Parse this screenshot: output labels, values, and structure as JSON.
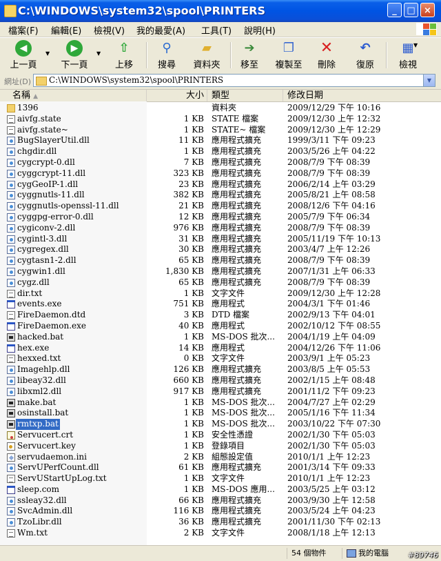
{
  "window": {
    "title": "C:\\WINDOWS\\system32\\spool\\PRINTERS"
  },
  "menu": [
    "檔案(F)",
    "編輯(E)",
    "檢視(V)",
    "我的最愛(A)",
    "工具(T)",
    "說明(H)"
  ],
  "toolbar": {
    "back": "上一頁",
    "forward": "下一頁",
    "up": "上移",
    "search": "搜尋",
    "folders": "資料夾",
    "move_to": "移至",
    "copy_to": "複製至",
    "delete": "刪除",
    "undo": "復原",
    "views": "檢視"
  },
  "address": {
    "label": "網址(D)",
    "value": "C:\\WINDOWS\\system32\\spool\\PRINTERS"
  },
  "columns": {
    "name": "名稱",
    "size": "大小",
    "type": "類型",
    "date": "修改日期"
  },
  "files": [
    {
      "name": "1396",
      "size": "",
      "type": "資料夾",
      "date": "2009/12/29 下午 10:16",
      "icon": "folder"
    },
    {
      "name": "aivfg.state",
      "size": "1 KB",
      "type": "STATE 檔案",
      "date": "2009/12/30 上午 12:32",
      "icon": "doc"
    },
    {
      "name": "aivfg.state~",
      "size": "1 KB",
      "type": "STATE~ 檔案",
      "date": "2009/12/30 上午 12:29",
      "icon": "doc"
    },
    {
      "name": "BugSlayerUtil.dll",
      "size": "11 KB",
      "type": "應用程式擴充",
      "date": "1999/3/11 下午 09:23",
      "icon": "dll"
    },
    {
      "name": "chgdir.dll",
      "size": "1 KB",
      "type": "應用程式擴充",
      "date": "2003/5/26 上午 04:22",
      "icon": "dll"
    },
    {
      "name": "cygcrypt-0.dll",
      "size": "7 KB",
      "type": "應用程式擴充",
      "date": "2008/7/9 下午 08:39",
      "icon": "dll"
    },
    {
      "name": "cyggcrypt-11.dll",
      "size": "323 KB",
      "type": "應用程式擴充",
      "date": "2008/7/9 下午 08:39",
      "icon": "dll"
    },
    {
      "name": "cygGeoIP-1.dll",
      "size": "23 KB",
      "type": "應用程式擴充",
      "date": "2006/2/14 上午 03:29",
      "icon": "dll"
    },
    {
      "name": "cyggnutls-11.dll",
      "size": "382 KB",
      "type": "應用程式擴充",
      "date": "2005/8/21 上午 08:58",
      "icon": "dll"
    },
    {
      "name": "cyggnutls-openssl-11.dll",
      "size": "21 KB",
      "type": "應用程式擴充",
      "date": "2008/12/6 下午 04:16",
      "icon": "dll"
    },
    {
      "name": "cyggpg-error-0.dll",
      "size": "12 KB",
      "type": "應用程式擴充",
      "date": "2005/7/9 下午 06:34",
      "icon": "dll"
    },
    {
      "name": "cygiconv-2.dll",
      "size": "976 KB",
      "type": "應用程式擴充",
      "date": "2008/7/9 下午 08:39",
      "icon": "dll"
    },
    {
      "name": "cygintl-3.dll",
      "size": "31 KB",
      "type": "應用程式擴充",
      "date": "2005/11/19 下午 10:13",
      "icon": "dll"
    },
    {
      "name": "cygregex.dll",
      "size": "30 KB",
      "type": "應用程式擴充",
      "date": "2003/4/7 上午 12:26",
      "icon": "dll"
    },
    {
      "name": "cygtasn1-2.dll",
      "size": "65 KB",
      "type": "應用程式擴充",
      "date": "2008/7/9 下午 08:39",
      "icon": "dll"
    },
    {
      "name": "cygwin1.dll",
      "size": "1,830 KB",
      "type": "應用程式擴充",
      "date": "2007/1/31 上午 06:33",
      "icon": "dll"
    },
    {
      "name": "cygz.dll",
      "size": "65 KB",
      "type": "應用程式擴充",
      "date": "2008/7/9 下午 08:39",
      "icon": "dll"
    },
    {
      "name": "dir.txt",
      "size": "1 KB",
      "type": "文字文件",
      "date": "2009/12/30 上午 12:28",
      "icon": "doc"
    },
    {
      "name": "events.exe",
      "size": "751 KB",
      "type": "應用程式",
      "date": "2004/3/1 下午 01:46",
      "icon": "exe"
    },
    {
      "name": "FireDaemon.dtd",
      "size": "3 KB",
      "type": "DTD 檔案",
      "date": "2002/9/13 下午 04:01",
      "icon": "doc"
    },
    {
      "name": "FireDaemon.exe",
      "size": "40 KB",
      "type": "應用程式",
      "date": "2002/10/12 下午 08:55",
      "icon": "exe"
    },
    {
      "name": "hacked.bat",
      "size": "1 KB",
      "type": "MS-DOS 批次...",
      "date": "2004/1/19 上午 04:09",
      "icon": "bat"
    },
    {
      "name": "hex.exe",
      "size": "14 KB",
      "type": "應用程式",
      "date": "2004/12/26 下午 11:06",
      "icon": "exe"
    },
    {
      "name": "hexxed.txt",
      "size": "0 KB",
      "type": "文字文件",
      "date": "2003/9/1 上午 05:23",
      "icon": "doc"
    },
    {
      "name": "Imagehlp.dll",
      "size": "126 KB",
      "type": "應用程式擴充",
      "date": "2003/8/5 上午 05:53",
      "icon": "dll"
    },
    {
      "name": "libeay32.dll",
      "size": "660 KB",
      "type": "應用程式擴充",
      "date": "2002/1/15 上午 08:48",
      "icon": "dll"
    },
    {
      "name": "libxml2.dll",
      "size": "917 KB",
      "type": "應用程式擴充",
      "date": "2001/11/2 下午 09:23",
      "icon": "dll"
    },
    {
      "name": "make.bat",
      "size": "1 KB",
      "type": "MS-DOS 批次...",
      "date": "2004/7/27 上午 02:29",
      "icon": "bat"
    },
    {
      "name": "osinstall.bat",
      "size": "1 KB",
      "type": "MS-DOS 批次...",
      "date": "2005/1/16 下午 11:34",
      "icon": "bat"
    },
    {
      "name": "rmtxp.bat",
      "size": "1 KB",
      "type": "MS-DOS 批次...",
      "date": "2003/10/22 下午 07:30",
      "icon": "bat",
      "selected": true
    },
    {
      "name": "Servucert.crt",
      "size": "1 KB",
      "type": "安全性憑證",
      "date": "2002/1/30 下午 05:03",
      "icon": "cert"
    },
    {
      "name": "Servucert.key",
      "size": "1 KB",
      "type": "登錄項目",
      "date": "2002/1/30 下午 05:03",
      "icon": "key"
    },
    {
      "name": "servudaemon.ini",
      "size": "2 KB",
      "type": "組態設定值",
      "date": "2010/1/1 上午 12:23",
      "icon": "ini"
    },
    {
      "name": "ServUPerfCount.dll",
      "size": "61 KB",
      "type": "應用程式擴充",
      "date": "2001/3/14 下午 09:33",
      "icon": "dll"
    },
    {
      "name": "ServUStartUpLog.txt",
      "size": "1 KB",
      "type": "文字文件",
      "date": "2010/1/1 上午 12:23",
      "icon": "doc"
    },
    {
      "name": "sleep.com",
      "size": "1 KB",
      "type": "MS-DOS 應用...",
      "date": "2003/5/25 上午 03:12",
      "icon": "exe"
    },
    {
      "name": "ssleay32.dll",
      "size": "66 KB",
      "type": "應用程式擴充",
      "date": "2003/9/30 上午 12:58",
      "icon": "dll"
    },
    {
      "name": "SvcAdmin.dll",
      "size": "116 KB",
      "type": "應用程式擴充",
      "date": "2003/5/24 上午 04:23",
      "icon": "dll"
    },
    {
      "name": "TzoLibr.dll",
      "size": "36 KB",
      "type": "應用程式擴充",
      "date": "2001/11/30 下午 02:13",
      "icon": "dll"
    },
    {
      "name": "Wm.txt",
      "size": "2 KB",
      "type": "文字文件",
      "date": "2008/1/18 上午 12:13",
      "icon": "doc"
    }
  ],
  "status": {
    "count": "54 個物件",
    "location": "我的電腦"
  },
  "watermark": "#89746"
}
